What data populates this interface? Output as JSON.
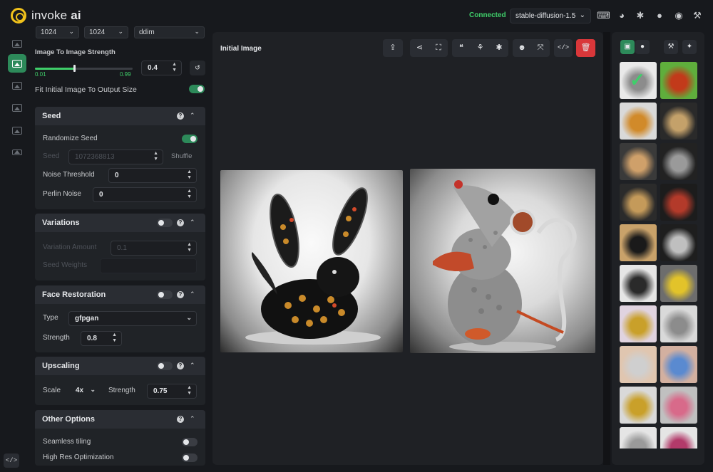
{
  "app": {
    "brand_prefix": "invoke",
    "brand_suffix": "ai"
  },
  "header": {
    "status": "Connected",
    "model": "stable-diffusion-1.5",
    "icons": [
      "keyboard-icon",
      "palette-icon",
      "bug-icon",
      "github-icon",
      "discord-icon",
      "wrench-icon"
    ]
  },
  "rail": {
    "items": [
      "text-to-image",
      "image-to-image",
      "unified-canvas",
      "nodes",
      "postprocessing",
      "training"
    ]
  },
  "top_row": {
    "width": "1024",
    "height": "1024",
    "sampler": "ddim"
  },
  "img2img": {
    "strength_label": "Image To Image Strength",
    "min": "0.01",
    "max": "0.99",
    "value": "0.4",
    "fraction": 0.4,
    "fit_label": "Fit Initial Image To Output Size",
    "fit_on": true
  },
  "seed": {
    "title": "Seed",
    "randomize_label": "Randomize Seed",
    "randomize_on": true,
    "seed_label": "Seed",
    "seed_value": "1072368813",
    "shuffle_label": "Shuffle",
    "noise_label": "Noise Threshold",
    "noise_value": "0",
    "perlin_label": "Perlin Noise",
    "perlin_value": "0"
  },
  "variations": {
    "title": "Variations",
    "on": false,
    "amount_label": "Variation Amount",
    "amount_value": "0.1",
    "weights_label": "Seed Weights"
  },
  "face": {
    "title": "Face Restoration",
    "on": false,
    "type_label": "Type",
    "type_value": "gfpgan",
    "strength_label": "Strength",
    "strength_value": "0.8"
  },
  "upscaling": {
    "title": "Upscaling",
    "on": false,
    "scale_label": "Scale",
    "scale_value": "4x",
    "strength_label": "Strength",
    "strength_value": "0.75"
  },
  "other": {
    "title": "Other Options",
    "seamless_label": "Seamless tiling",
    "seamless_on": false,
    "hires_label": "High Res Optimization",
    "hires_on": false
  },
  "main": {
    "title": "Initial Image",
    "toolbar": [
      "upload-icon",
      "share-icon",
      "fullscreen-icon",
      "quote-icon",
      "seedling-icon",
      "asterisk-icon",
      "face-icon",
      "expand-icon",
      "code-icon",
      "trash-icon"
    ],
    "images": [
      "glass-rabbit-image",
      "glass-mouse-image"
    ]
  },
  "gallery": {
    "thumbnails": 20
  }
}
